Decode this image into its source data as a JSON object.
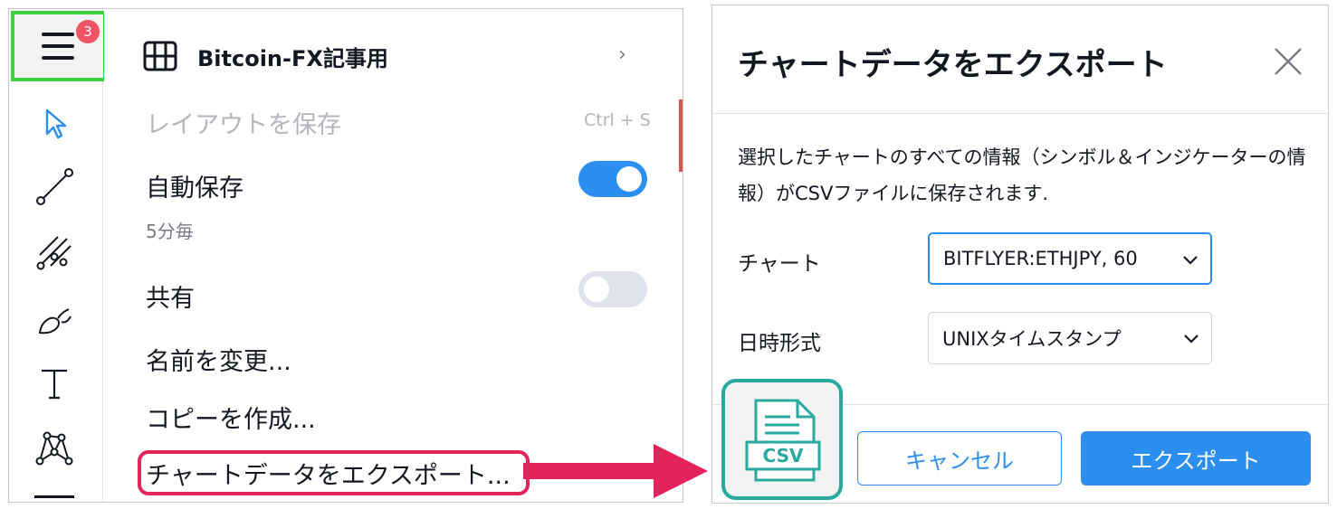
{
  "menu_button": {
    "badge": "3"
  },
  "menu": {
    "layout_name": "Bitcoin-FX記事用",
    "save_layout": "レイアウトを保存",
    "save_shortcut": "Ctrl + S",
    "autosave": "自動保存",
    "autosave_interval": "5分毎",
    "autosave_on": true,
    "share": "共有",
    "share_on": false,
    "rename": "名前を変更...",
    "copy": "コピーを作成...",
    "export_data": "チャートデータをエクスポート..."
  },
  "dialog": {
    "title": "チャートデータをエクスポート",
    "description": "選択したチャートのすべての情報（シンボル＆インジケーターの情報）がCSVファイルに保存されます.",
    "chart_label": "チャート",
    "chart_value": "BITFLYER:ETHJPY, 60",
    "datetime_label": "日時形式",
    "datetime_value": "UNIXタイムスタンプ",
    "csv_icon_text": "CSV",
    "cancel_label": "キャンセル",
    "export_label": "エクスポート"
  },
  "colors": {
    "accent": "#2c8ff0",
    "highlight": "#e3245a",
    "menu_highlight_border": "#3ed13e",
    "csv_border": "#2aa9a0"
  },
  "icons": {
    "toolbar": [
      "cursor-icon",
      "trend-line-icon",
      "pitchfork-icon",
      "brush-icon",
      "text-icon",
      "pattern-icon"
    ]
  }
}
